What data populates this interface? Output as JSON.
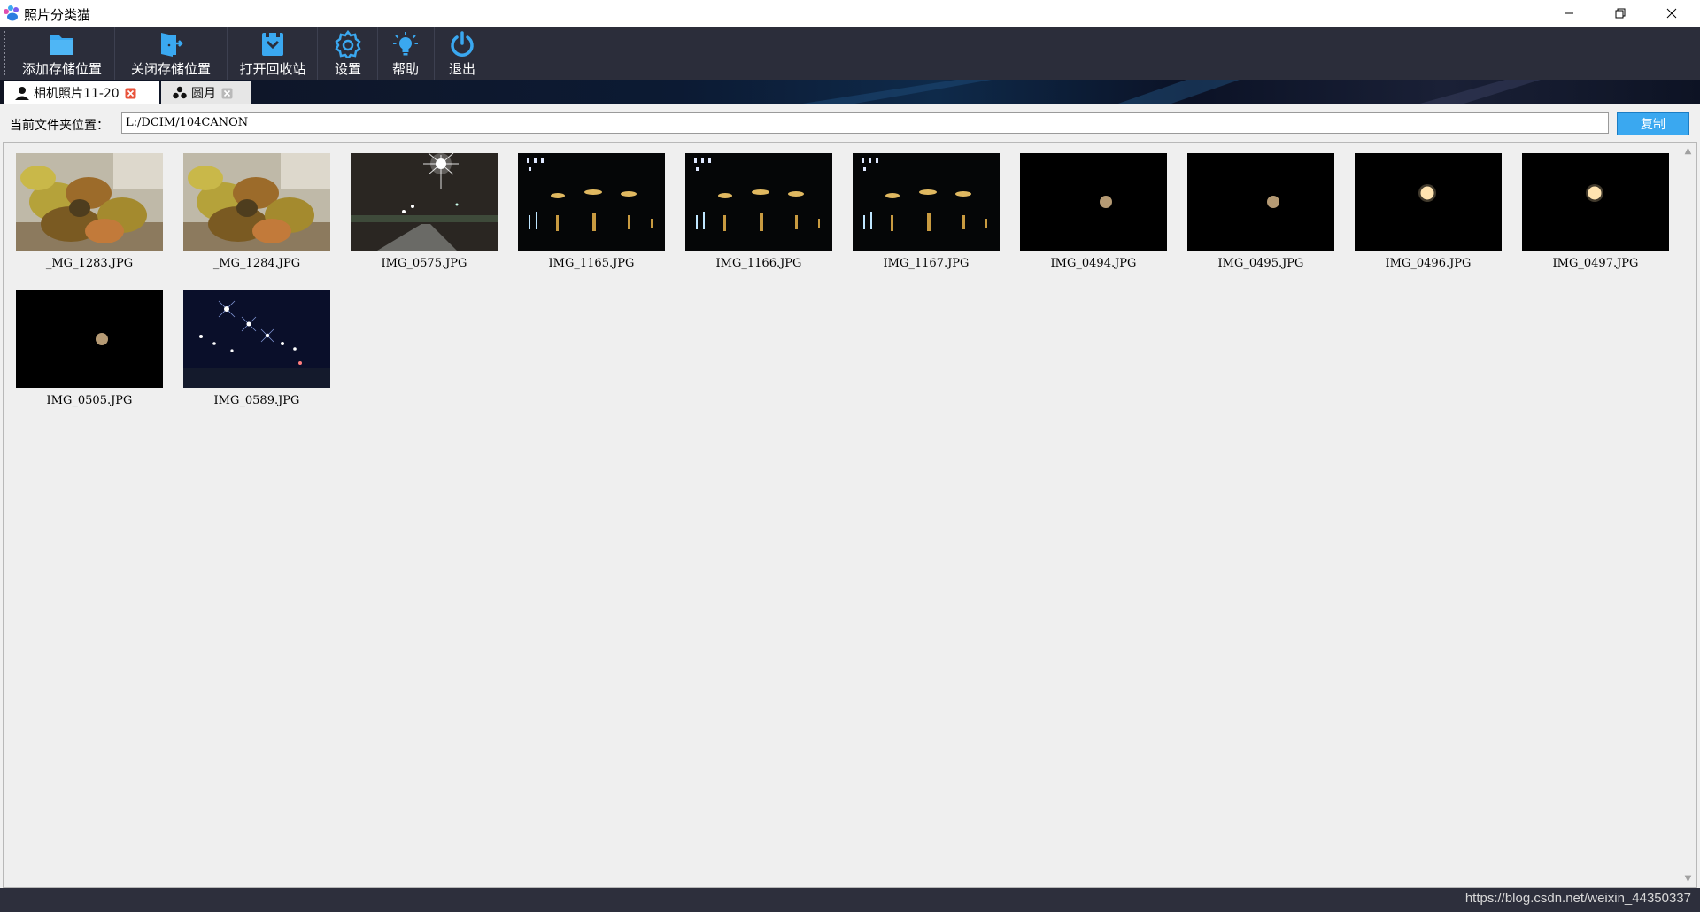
{
  "app": {
    "title": "照片分类猫",
    "window_controls": [
      "minimize",
      "restore",
      "close"
    ]
  },
  "toolbar": {
    "items": [
      {
        "label": "添加存储位置",
        "icon": "folder-icon"
      },
      {
        "label": "关闭存储位置",
        "icon": "door-exit-icon"
      },
      {
        "label": "打开回收站",
        "icon": "recycle-bin-icon"
      },
      {
        "label": "设置",
        "icon": "gear-icon"
      },
      {
        "label": "帮助",
        "icon": "lightbulb-icon"
      },
      {
        "label": "退出",
        "icon": "power-icon"
      }
    ]
  },
  "tabs": [
    {
      "label": "相机照片11-20",
      "active": true,
      "icon": "person-icon"
    },
    {
      "label": "圆月",
      "active": false,
      "icon": "group-icon"
    }
  ],
  "path_bar": {
    "label": "当前文件夹位置：",
    "value": "L:/DCIM/104CANON",
    "copy_label": "复制"
  },
  "photos": [
    {
      "name": "_MG_1283.JPG",
      "kind": "plant"
    },
    {
      "name": "_MG_1284.JPG",
      "kind": "plant"
    },
    {
      "name": "IMG_0575.JPG",
      "kind": "streetlight"
    },
    {
      "name": "IMG_1165.JPG",
      "kind": "lake-night"
    },
    {
      "name": "IMG_1166.JPG",
      "kind": "lake-night"
    },
    {
      "name": "IMG_1167.JPG",
      "kind": "lake-night"
    },
    {
      "name": "IMG_0494.JPG",
      "kind": "moon-dim"
    },
    {
      "name": "IMG_0495.JPG",
      "kind": "moon-dim"
    },
    {
      "name": "IMG_0496.JPG",
      "kind": "moon-bright"
    },
    {
      "name": "IMG_0497.JPG",
      "kind": "moon-bright"
    },
    {
      "name": "IMG_0505.JPG",
      "kind": "moon-dim"
    },
    {
      "name": "IMG_0589.JPG",
      "kind": "road-lights"
    }
  ],
  "watermark": "https://blog.csdn.net/weixin_44350337",
  "colors": {
    "toolbar_bg": "#2b2d3a",
    "icon_blue": "#3aa8f0",
    "copy_button": "#3aa8f0",
    "panel_bg": "#f0f0f0"
  }
}
